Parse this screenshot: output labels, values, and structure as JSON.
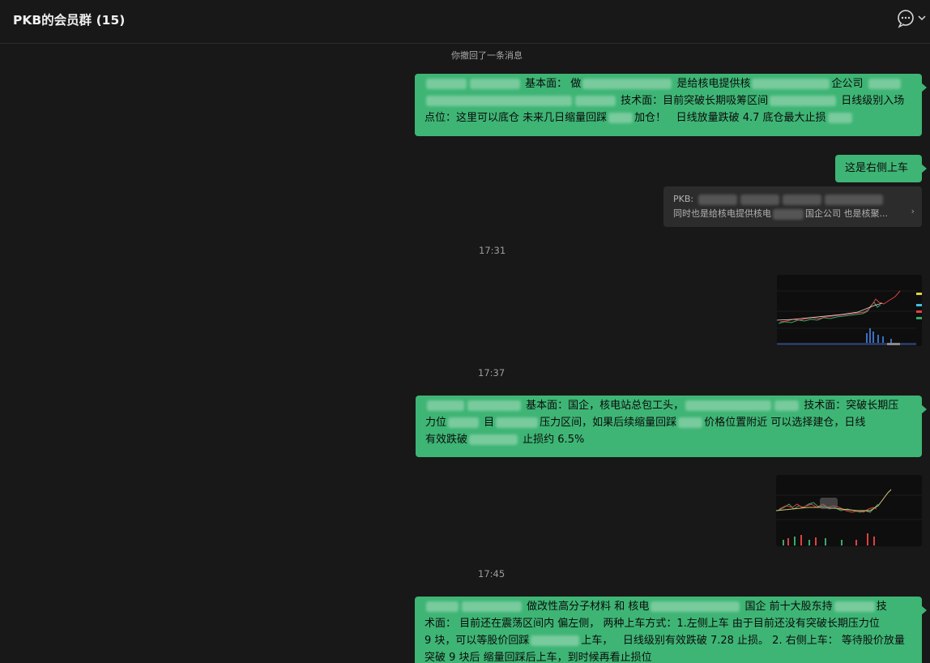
{
  "header": {
    "title": "PKB的会员群 (15)",
    "icons": [
      "chat-bubble-icon",
      "chevron-down-icon"
    ]
  },
  "messages": {
    "recall_notice": "你撤回了一条消息",
    "msg1": {
      "p1": "基本面：",
      "p2": "做",
      "p3": "是给核电提供核",
      "p4": "企公司",
      "p5": "技术面：目前突破长期吸筹区间",
      "p6": "日线级别入场",
      "p7": "点位：这里可以底仓 未来几日缩量回踩",
      "p8": "加仓！",
      "p9": "日线放量跌破 4.7 底仓最大止损"
    },
    "msg2": "这是右侧上车",
    "quote": {
      "line1": "PKB:",
      "line2a": "同时也是给核电提供核电",
      "line2b": "国企公司 也是核聚..."
    },
    "time1": "17:31",
    "time2": "17:37",
    "msg3": {
      "p1": "基本面：国企，核电站总包工头，",
      "p2": "技术面：突破长期压",
      "p3": "力位",
      "p4": "目",
      "p5": "压力区间，如果后续缩量回踩",
      "p6": "价格位置附近 可以选择建仓，日线",
      "p7": "有效跌破",
      "p8": "止损约 6.5%"
    },
    "time3": "17:45",
    "msg4": {
      "p1": "做改性高分子材料 和 核电",
      "p2": "国企 前十大股东持",
      "p3": "技",
      "p4": "术面： 目前还在震荡区间内 偏左侧， 两种上车方式：1.左侧上车 由于目前还没有突破长期压力位",
      "p5": "9 块，可以等股价回踩",
      "p6": "上车，",
      "p7": "日线级别有效跌破 7.28 止损。 2. 右侧上车：",
      "p8": "等待股价放量",
      "p9": "突破 9 块后 缩量回踩后上车，到时候再看止损位"
    }
  },
  "chart_colors": {
    "up": "#e04040",
    "down": "#3aa86b",
    "accent": "#ffffff"
  }
}
